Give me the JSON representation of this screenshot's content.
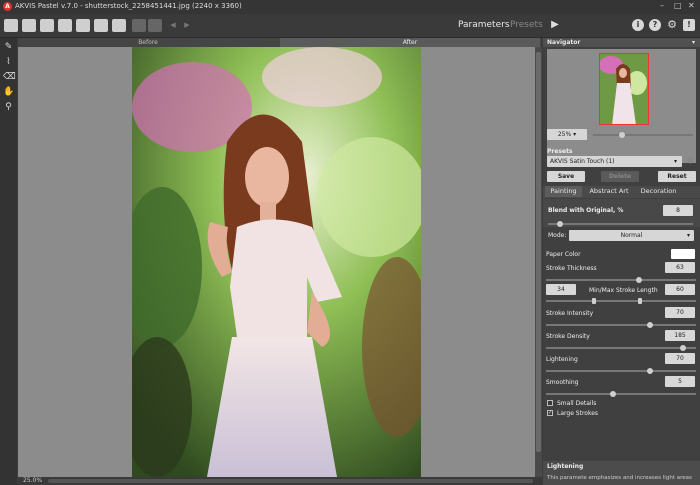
{
  "window": {
    "title": "AKVIS Pastel v.7.0 - shutterstock_2258451441.jpg (2240 x 3360)",
    "logo_letter": "A",
    "controls": [
      "–",
      "□",
      "✕"
    ]
  },
  "toolbar": {
    "parameters_label": "Parameters",
    "presets_label": "Presets",
    "run_glyph": "▶",
    "info_glyph": "i",
    "help_glyph": "?",
    "settings_glyph": "⚙",
    "notify_glyph": "!"
  },
  "view_tabs": {
    "before": "Before",
    "after": "After"
  },
  "status": {
    "zoom": "25.0%"
  },
  "navigator": {
    "title": "Navigator",
    "zoom_value": "25% ▾"
  },
  "presets": {
    "title": "Presets",
    "selected": "AKVIS Satin Touch (1)",
    "save": "Save",
    "delete": "Delete",
    "reset": "Reset"
  },
  "tabs": {
    "painting": "Painting",
    "abstract_art": "Abstract Art",
    "decoration": "Decoration"
  },
  "params": {
    "blend_label": "Blend with Original, %",
    "blend_value": "8",
    "mode_label": "Mode:",
    "mode_value": "Normal",
    "paper_color_label": "Paper Color",
    "paper_color": "#ffffff",
    "stroke_thickness_label": "Stroke Thickness",
    "stroke_thickness_value": "63",
    "min_stroke_value": "34",
    "minmax_label": "Min/Max Stroke Length",
    "max_stroke_value": "60",
    "stroke_intensity_label": "Stroke Intensity",
    "stroke_intensity_value": "70",
    "stroke_density_label": "Stroke Density",
    "stroke_density_value": "185",
    "lightening_label": "Lightening",
    "lightening_value": "70",
    "smoothing_label": "Smoothing",
    "smoothing_value": "5",
    "small_details_label": "Small Details",
    "large_strokes_label": "Large Strokes"
  },
  "hint": {
    "title": "Lightening",
    "text": "This paramete emphasizes and increases light areas"
  }
}
